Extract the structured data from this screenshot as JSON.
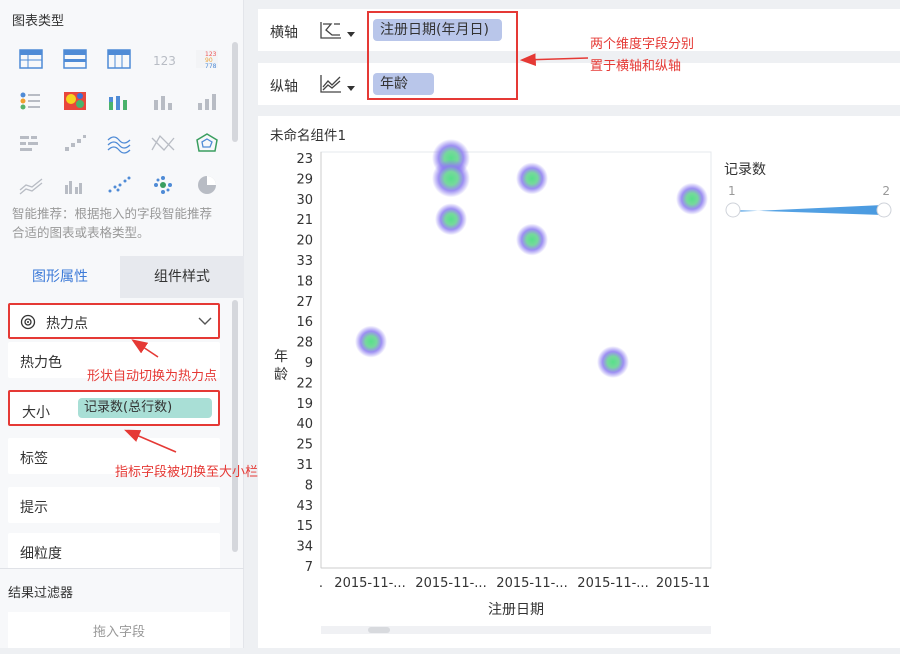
{
  "left_panel": {
    "chart_type_title": "图表类型",
    "chart_type_icons": [
      "grid-table-icon",
      "grouped-table-icon",
      "cross-table-icon",
      "kpi-number-icon",
      "colored-table-icon",
      "legend-list-icon",
      "heatmap-grid-icon",
      "stacked-column-icon",
      "bar-chart-icon",
      "column-chart-icon",
      "horizontal-bar-icon",
      "scatter-steps-icon",
      "multi-line-icon",
      "cross-line-icon",
      "radar-icon",
      "area-line-icon",
      "grouped-column-icon",
      "scatter-dots-icon",
      "heat-point-icon",
      "pie-chart-icon"
    ],
    "recommend_text": "智能推荐：根据拖入的字段智能推荐合适的图表或表格类型。",
    "tabs": [
      "图形属性",
      "组件样式"
    ],
    "shape_value": "热力点",
    "props": {
      "heat_color": "热力色",
      "size": "大小",
      "size_field": "记录数(总行数)",
      "label": "标签",
      "tooltip": "提示",
      "granularity": "细粒度"
    },
    "filter_title": "结果过滤器",
    "drop_field": "拖入字段"
  },
  "axes": {
    "x_label": "横轴",
    "x_field": "注册日期(年月日)",
    "y_label": "纵轴",
    "y_field": "年龄"
  },
  "annotations": {
    "axes_note_line1": "两个维度字段分别",
    "axes_note_line2": "置于横轴和纵轴",
    "shape_note": "形状自动切换为热力点",
    "size_note": "指标字段被切换至大小栏"
  },
  "widget_title": "未命名组件1",
  "legend": {
    "title": "记录数",
    "min_label": "1",
    "max_label": "2"
  },
  "colors": {
    "accent": "#3e7bd8",
    "annotation_red": "#e53935",
    "chip_blue": "#b9c6ea",
    "chip_teal": "#a9dfd6",
    "legend_bar": "#5aa6e6"
  },
  "chart_data": {
    "type": "heatmap",
    "xlabel": "注册日期",
    "ylabel": "年龄",
    "x_categories": [
      ".",
      "2015-11-...",
      "2015-11-...",
      "2015-11-...",
      "2015-11-...",
      "2015-11"
    ],
    "y_categories": [
      "23",
      "29",
      "30",
      "21",
      "20",
      "33",
      "18",
      "27",
      "16",
      "28",
      "9",
      "22",
      "19",
      "40",
      "25",
      "31",
      "8",
      "43",
      "15",
      "34",
      "7"
    ],
    "points": [
      {
        "x_index": 1,
        "y": "23",
        "value": 2
      },
      {
        "x_index": 1,
        "y": "29",
        "value": 2
      },
      {
        "x_index": 1,
        "y": "21",
        "value": 1
      },
      {
        "x_index": 2,
        "y": "29",
        "value": 1
      },
      {
        "x_index": 2,
        "y": "20",
        "value": 1
      },
      {
        "x_index": 4,
        "y": "30",
        "value": 1
      },
      {
        "x_index": 0,
        "y": "28",
        "value": 1
      },
      {
        "x_index": 3,
        "y": "9",
        "value": 1
      }
    ],
    "legend_range": [
      1,
      2
    ]
  }
}
